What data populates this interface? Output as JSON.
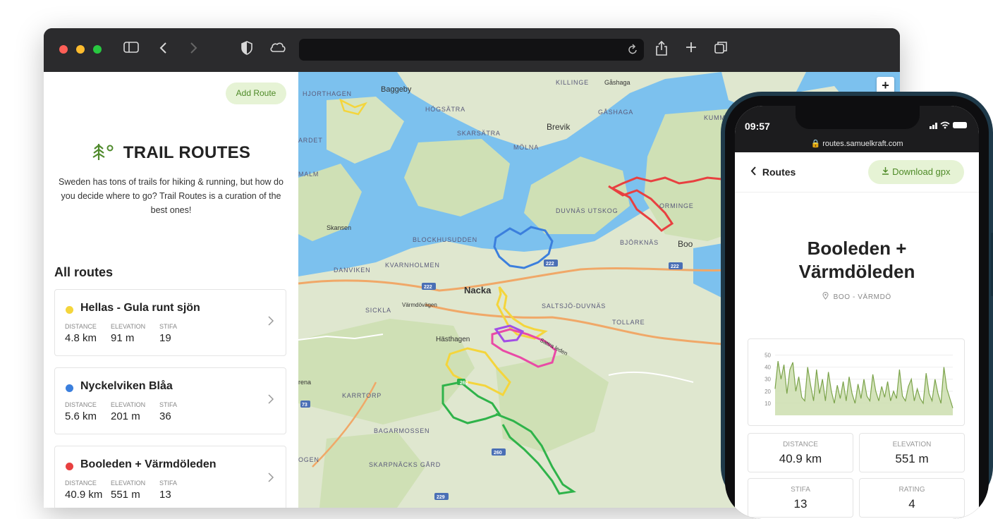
{
  "browser": {
    "icons": [
      "sidebar-icon",
      "back-icon",
      "forward-icon",
      "shield-icon",
      "cloud-icon",
      "reload-icon",
      "share-icon",
      "plus-icon",
      "tabs-icon"
    ]
  },
  "sidebar": {
    "add_route": "Add Route",
    "logo_text": "TRAIL ROUTES",
    "intro": "Sweden has tons of trails for hiking & running, but how do you decide where to go? Trail Routes is a curation of the best ones!",
    "section_title": "All routes",
    "labels": {
      "distance": "DISTANCE",
      "elevation": "ELEVATION",
      "stifa": "STIFA"
    },
    "routes": [
      {
        "name": "Hellas - Gula runt sjön",
        "color": "#f4d53c",
        "distance": "4.8 km",
        "elevation": "91 m",
        "stifa": "19"
      },
      {
        "name": "Nyckelviken Blåa",
        "color": "#3b7fdd",
        "distance": "5.6 km",
        "elevation": "201 m",
        "stifa": "36"
      },
      {
        "name": "Booleden + Värmdöleden",
        "color": "#e84040",
        "distance": "40.9 km",
        "elevation": "551 m",
        "stifa": "13"
      }
    ]
  },
  "map": {
    "zoom_in": "+",
    "labels": {
      "hjorthagen": "HJORTHAGEN",
      "baggeby": "Baggeby",
      "hogsatra": "HÖGSÄTRA",
      "killinge": "KILLINGE",
      "gashaga": "Gåshaga",
      "skarsatra": "SKARSÄTRA",
      "brevik": "Brevik",
      "molna": "MÖLNA",
      "gashaga2": "GÅSHAGA",
      "kumm": "KUMM",
      "ardet": "ARDET",
      "malm": "MALM",
      "skansen": "Skansen",
      "blockhusudden": "BLOCKHUSUDDEN",
      "duvnas_utskog": "DUVNÄS UTSKOG",
      "orminge": "ORMINGE",
      "bjorknas": "BJÖRKNÄS",
      "boo": "Boo",
      "danviken": "DANVIKEN",
      "kvarnholmen": "KVARNHOLMEN",
      "nacka": "Nacka",
      "varmdovagen": "Värmdövägen",
      "sickla": "SICKLA",
      "saltsjo_duvnas": "SALTSJÖ-DUVNÄS",
      "tollare": "TOLLARE",
      "hasthagen": "Hästhagen",
      "sattranitsleden": "Sattra leden",
      "karrtorp": "KARRTORP",
      "rena": "rena",
      "bagarmossen": "BAGARMOSSEN",
      "skarpnacks_gard": "SKARPNÄCKS GÅRD",
      "ogen": "OGEN",
      "r222a": "222",
      "r222b": "222",
      "r222c": "222",
      "r260a": "260",
      "r260b": "260",
      "r73": "73",
      "r229": "229"
    }
  },
  "phone": {
    "time": "09:57",
    "status_icons": "signal wifi battery",
    "url": "routes.samuelkraft.com",
    "back_label": "Routes",
    "download_label": "Download gpx",
    "title_line1": "Booleden +",
    "title_line2": "Värmdöleden",
    "location": "BOO - VÄRMDÖ",
    "chart_data": {
      "type": "area",
      "ylim": [
        0,
        55
      ],
      "yticks": [
        "50",
        "40",
        "30",
        "20",
        "10"
      ],
      "color": "#7ba34a",
      "values": [
        22,
        45,
        30,
        42,
        18,
        38,
        44,
        20,
        32,
        15,
        12,
        40,
        25,
        12,
        38,
        18,
        30,
        12,
        36,
        20,
        10,
        25,
        14,
        28,
        12,
        32,
        18,
        10,
        26,
        14,
        30,
        16,
        12,
        34,
        20,
        12,
        24,
        15,
        28,
        12,
        20,
        14,
        38,
        16,
        12,
        24,
        30,
        12,
        22,
        14,
        10,
        35,
        18,
        12,
        30,
        18,
        10,
        40,
        22,
        14,
        6
      ]
    },
    "stats": [
      {
        "label": "DISTANCE",
        "value": "40.9 km"
      },
      {
        "label": "ELEVATION",
        "value": "551 m"
      },
      {
        "label": "STIFA",
        "value": "13"
      },
      {
        "label": "RATING",
        "value": "4"
      }
    ]
  }
}
